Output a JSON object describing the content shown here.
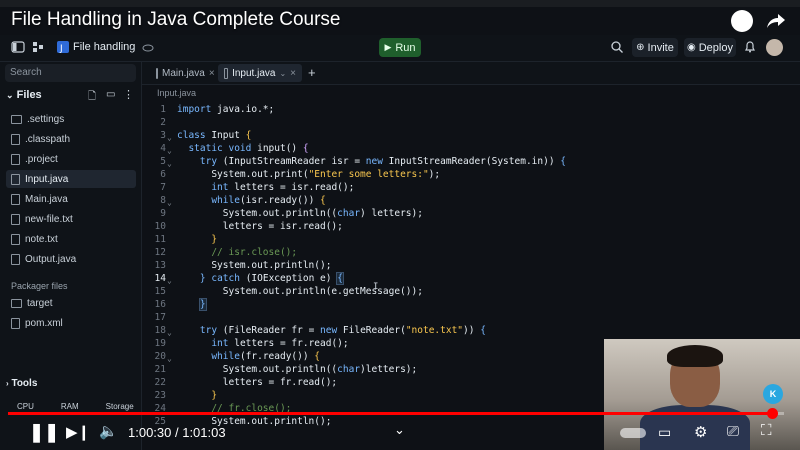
{
  "video": {
    "title": "File Handling in Java Complete Course",
    "time": "1:00:30 / 1:01:03",
    "progress_fraction": 0.985
  },
  "header": {
    "project_name": "File handling",
    "run_label": "Run",
    "invite_label": "Invite",
    "deploy_label": "Deploy"
  },
  "sidebar": {
    "search_placeholder": "Search",
    "files_label": "Files",
    "items": [
      {
        "label": ".settings",
        "kind": "folder"
      },
      {
        "label": ".classpath",
        "kind": "file"
      },
      {
        "label": ".project",
        "kind": "file"
      },
      {
        "label": "Input.java",
        "kind": "file",
        "active": true
      },
      {
        "label": "Main.java",
        "kind": "file"
      },
      {
        "label": "new-file.txt",
        "kind": "file"
      },
      {
        "label": "note.txt",
        "kind": "file"
      },
      {
        "label": "Output.java",
        "kind": "file"
      }
    ],
    "packager_label": "Packager files",
    "packager_items": [
      {
        "label": "target",
        "kind": "folder"
      },
      {
        "label": "pom.xml",
        "kind": "file"
      }
    ],
    "tools_label": "Tools",
    "resources": [
      "CPU",
      "RAM",
      "Storage"
    ]
  },
  "tabs": [
    {
      "label": "Main.java",
      "active": false
    },
    {
      "label": "Input.java",
      "active": true
    }
  ],
  "breadcrumb": "Input.java",
  "editor": {
    "current_line": 14,
    "line_numbers": [
      "1",
      "2",
      "3",
      "4",
      "5",
      "6",
      "7",
      "8",
      "9",
      "10",
      "11",
      "12",
      "13",
      "14",
      "15",
      "16",
      "17",
      "18",
      "19",
      "20",
      "21",
      "22",
      "23",
      "24",
      "25"
    ]
  },
  "colors": {
    "accent_run": "#1f5f2c",
    "progress": "#ff0000",
    "editor_bg": "#0e1116"
  }
}
